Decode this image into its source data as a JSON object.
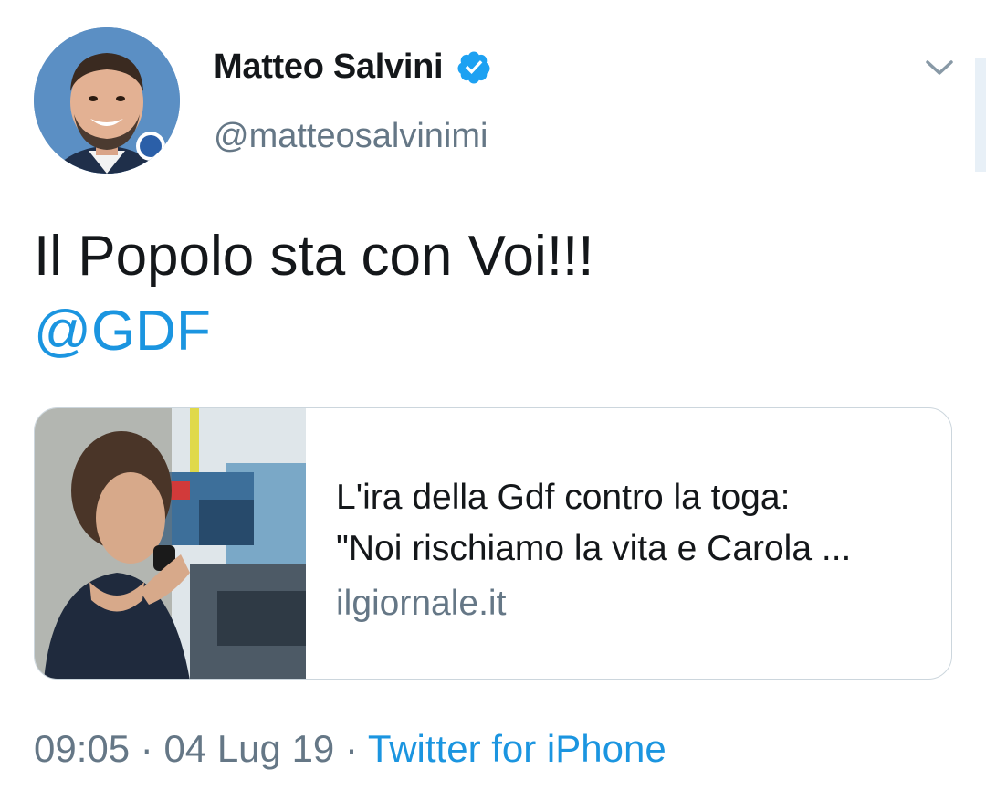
{
  "author": {
    "display_name": "Matteo Salvini",
    "handle": "@matteosalvinimi",
    "verified": true,
    "avatar_icon": "profile-photo"
  },
  "tweet": {
    "text": "Il Popolo sta con Voi!!!",
    "mention": "@GDF"
  },
  "card": {
    "title_line1": "L'ira della Gdf contro la toga:",
    "title_line2": "\"Noi rischiamo la vita e Carola ...",
    "domain": "ilgiornale.it",
    "image_icon": "article-photo"
  },
  "meta": {
    "time": "09:05",
    "separator1": " · ",
    "date": "04 Lug 19",
    "separator2": " · ",
    "source": "Twitter for iPhone"
  },
  "colors": {
    "link": "#1b95e0",
    "secondary_text": "#657786",
    "primary_text": "#14171a",
    "border": "#ccd6dd"
  }
}
